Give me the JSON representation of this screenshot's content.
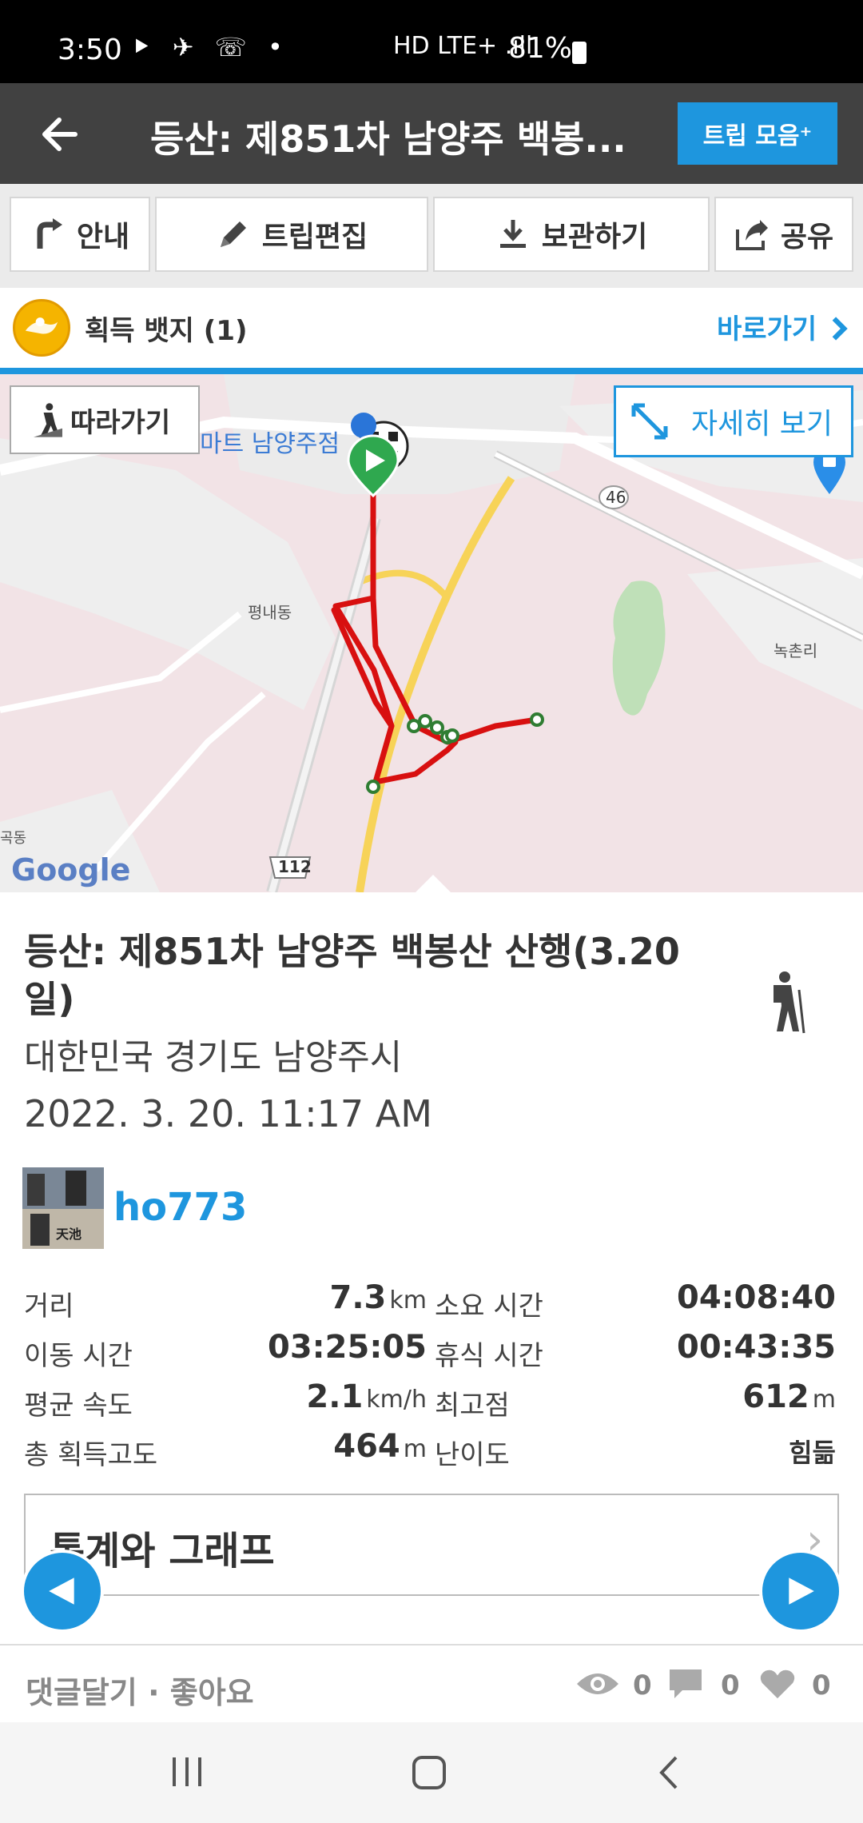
{
  "status_bar": {
    "time": "3:50",
    "notification_icons": "⯈ ✈ ☏ •",
    "network": "HD LTE+ .ıll",
    "battery": "81%"
  },
  "app_bar": {
    "title": "등산: 제851차 남양주 백봉...",
    "trip_collection_button": "트립 모음⁺"
  },
  "toolbar": {
    "guide": "안내",
    "edit_trip": "트립편집",
    "save": "보관하기",
    "share": "공유"
  },
  "badge": {
    "label": "획득 뱃지 (1)",
    "shortcut": "바로가기"
  },
  "map": {
    "follow_button": "따라가기",
    "detail_button": "자세히 보기",
    "labels": {
      "mart": "마트 남양주점",
      "pyeongnae": "평내동",
      "nokchon": "녹촌리",
      "road46": "46",
      "road112": "112",
      "gokdong": "곡동",
      "google": "Google"
    },
    "colors": {
      "route": "#d81010",
      "start": "#2fa84f",
      "background": "#f2e3e6"
    }
  },
  "trip": {
    "title": "등산: 제851차 남양주 백봉산 산행(3.20 일)",
    "location": "대한민국 경기도 남양주시",
    "datetime": "2022. 3. 20. 11:17 AM",
    "user": "ho773",
    "avatar_text": "天池"
  },
  "stats": {
    "distance_label": "거리",
    "distance_value": "7.3",
    "distance_unit": "km",
    "duration_label": "소요 시간",
    "duration_value": "04:08:40",
    "moving_label": "이동 시간",
    "moving_value": "03:25:05",
    "rest_label": "휴식 시간",
    "rest_value": "00:43:35",
    "speed_label": "평균 속도",
    "speed_value": "2.1",
    "speed_unit": "km/h",
    "max_alt_label": "최고점",
    "max_alt_value": "612",
    "max_alt_unit": "m",
    "gain_label": "총 획득고도",
    "gain_value": "464",
    "gain_unit": "m",
    "difficulty_label": "난이도",
    "difficulty_value": "힘듦"
  },
  "graph_section": {
    "label": "통계와 그래프",
    "chevron": "›"
  },
  "comment_bar": {
    "text": "댓글달기 · 좋아요",
    "views": "0",
    "comments": "0",
    "likes": "0"
  },
  "accent_color": "#1e96de"
}
